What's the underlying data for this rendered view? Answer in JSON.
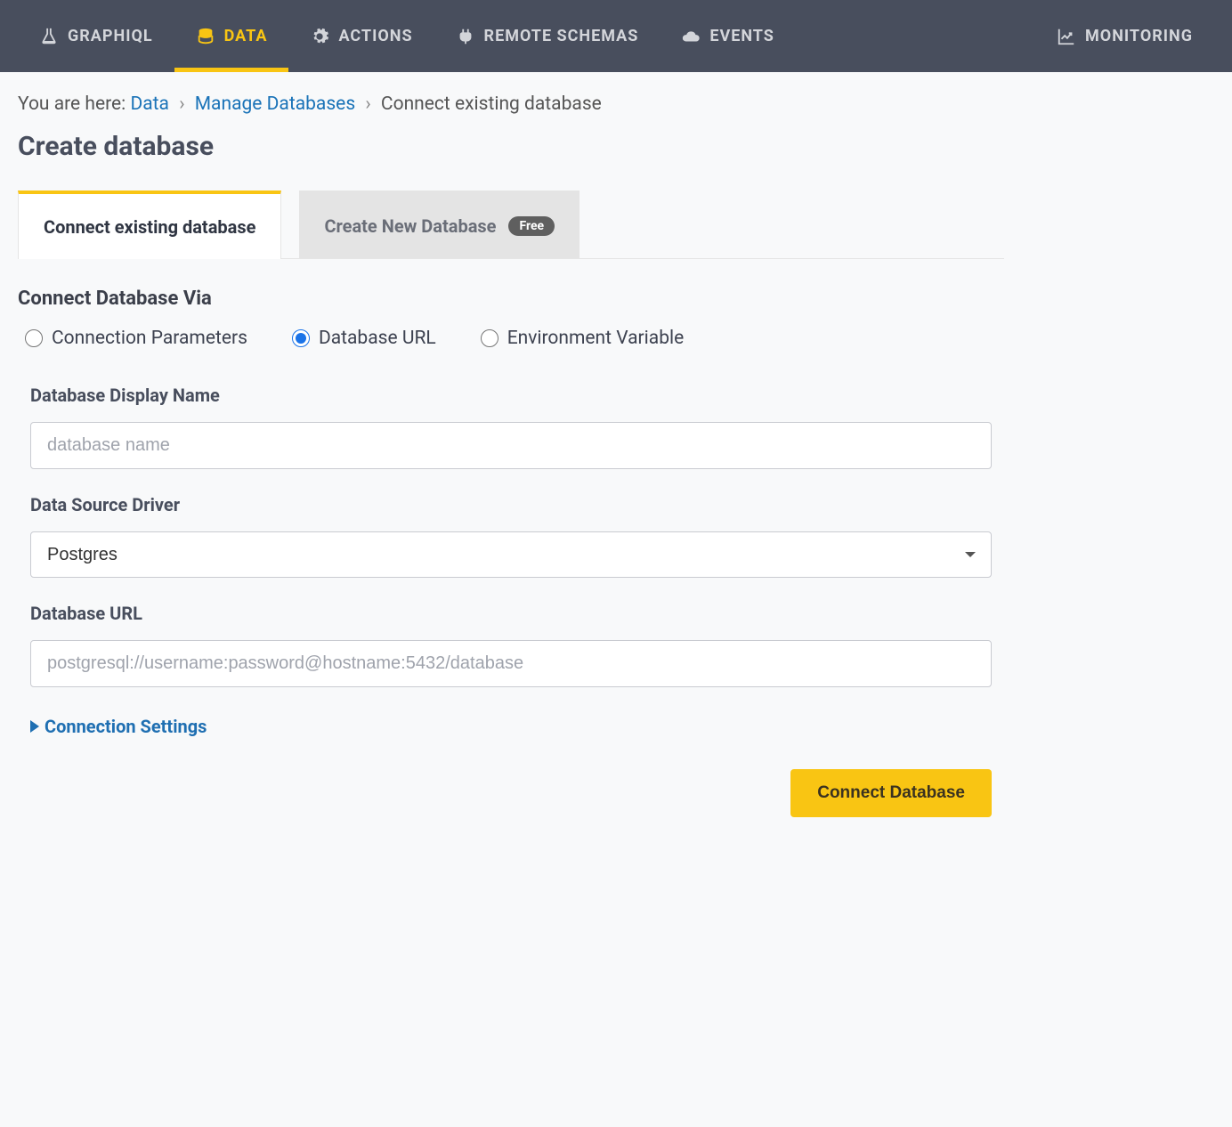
{
  "nav": {
    "items": [
      {
        "label": "GRAPHIQL",
        "icon": "flask-icon",
        "active": false
      },
      {
        "label": "DATA",
        "icon": "database-icon",
        "active": true
      },
      {
        "label": "ACTIONS",
        "icon": "gear-icon",
        "active": false
      },
      {
        "label": "REMOTE SCHEMAS",
        "icon": "plug-icon",
        "active": false
      },
      {
        "label": "EVENTS",
        "icon": "cloud-icon",
        "active": false
      },
      {
        "label": "MONITORING",
        "icon": "chart-icon",
        "active": false
      }
    ]
  },
  "breadcrumb": {
    "prefix": "You are here:",
    "items": [
      {
        "label": "Data",
        "link": true
      },
      {
        "label": "Manage Databases",
        "link": true
      },
      {
        "label": "Connect existing database",
        "link": false
      }
    ],
    "sep": "›"
  },
  "page_title": "Create database",
  "tabs": {
    "connect_existing": "Connect existing database",
    "create_new": "Create New Database",
    "free_badge": "Free"
  },
  "connect_via": {
    "heading": "Connect Database Via",
    "options": {
      "params": "Connection Parameters",
      "url": "Database URL",
      "env": "Environment Variable"
    },
    "selected": "url"
  },
  "form": {
    "display_name": {
      "label": "Database Display Name",
      "placeholder": "database name",
      "value": ""
    },
    "driver": {
      "label": "Data Source Driver",
      "value": "Postgres"
    },
    "db_url": {
      "label": "Database URL",
      "placeholder": "postgresql://username:password@hostname:5432/database",
      "value": ""
    }
  },
  "connection_settings_label": "Connection Settings",
  "submit_label": "Connect Database"
}
